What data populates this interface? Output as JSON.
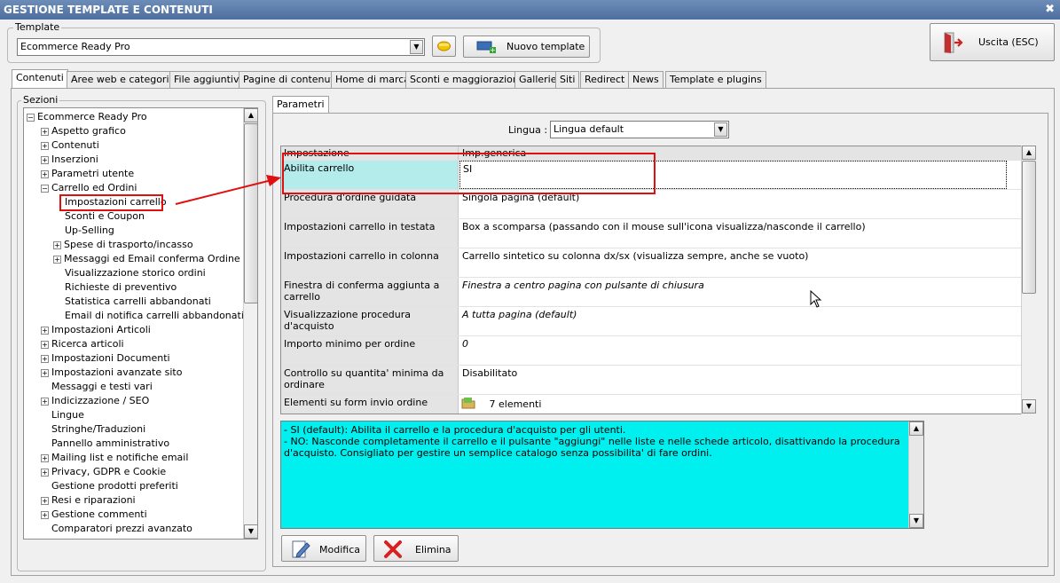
{
  "window": {
    "title": "GESTIONE TEMPLATE E CONTENUTI",
    "close": "✖"
  },
  "template": {
    "label": "Template",
    "selected": "Ecommerce Ready Pro",
    "new_button": "Nuovo template"
  },
  "exit_button": "Uscita (ESC)",
  "tabs": [
    "Contenuti",
    "Aree web e categorie",
    "File aggiuntivi",
    "Pagine di contenuti",
    "Home di marca",
    "Sconti e maggiorazioni",
    "Gallerie",
    "Siti",
    "Redirect",
    "News",
    "Template e plugins"
  ],
  "sections": {
    "label": "Sezioni",
    "root": "Ecommerce Ready Pro",
    "items": [
      "Aspetto grafico",
      "Contenuti",
      "Inserzioni",
      "Parametri utente",
      "Carrello ed Ordini",
      "Impostazioni carrello",
      "Sconti e Coupon",
      "Up-Selling",
      "Spese di trasporto/incasso",
      "Messaggi ed Email conferma Ordine",
      "Visualizzazione storico ordini",
      "Richieste di preventivo",
      "Statistica carrelli abbandonati",
      "Email di notifica carrelli abbandonati",
      "Impostazioni Articoli",
      "Ricerca articoli",
      "Impostazioni Documenti",
      "Impostazioni avanzate sito",
      "Messaggi e testi vari",
      "Indicizzazione / SEO",
      "Lingue",
      "Stringhe/Traduzioni",
      "Pannello amministrativo",
      "Mailing list e notifiche email",
      "Privacy, GDPR e Cookie",
      "Gestione prodotti preferiti",
      "Resi e riparazioni",
      "Gestione commenti",
      "Comparatori prezzi avanzato"
    ]
  },
  "params": {
    "tab": "Parametri",
    "lingua_label": "Lingua :",
    "lingua_value": "Lingua default",
    "header": {
      "key": "Impostazione",
      "value": "Imp.generica"
    },
    "rows": [
      {
        "key": "Abilita carrello",
        "value": "SI"
      },
      {
        "key": "Procedura d'ordine guidata",
        "value": "Singola pagina (default)"
      },
      {
        "key": "Impostazioni carrello in testata",
        "value": "Box a scomparsa (passando con il mouse sull'icona visualizza/nasconde il carrello)"
      },
      {
        "key": "Impostazioni carrello in colonna",
        "value": "Carrello sintetico su colonna dx/sx (visualizza sempre, anche se vuoto)"
      },
      {
        "key": "Finestra di conferma aggiunta a carrello",
        "value": "Finestra a centro pagina con pulsante di chiusura"
      },
      {
        "key": "Visualizzazione procedura d'acquisto",
        "value": "A tutta pagina (default)"
      },
      {
        "key": "Importo minimo per ordine",
        "value": "0"
      },
      {
        "key": "Controllo su quantita' minima da ordinare",
        "value": "Disabilitato"
      },
      {
        "key": "Elementi su form invio ordine",
        "value": "7 elementi"
      }
    ]
  },
  "description": {
    "line1": "- SI (default): Abilita il carrello e la procedura d'acquisto per gli utenti.",
    "line2": "- NO: Nasconde completamente il carrello e il pulsante \"aggiungi\" nelle liste e nelle schede articolo, disattivando la procedura d'acquisto. Consigliato per gestire un semplice catalogo senza possibilita' di fare ordini."
  },
  "buttons": {
    "modifica": "Modifica",
    "elimina": "Elimina"
  },
  "colors": {
    "highlight_red": "#e01010",
    "desc_bg": "#00f0f0",
    "selected_key_bg": "#b4ecec"
  }
}
